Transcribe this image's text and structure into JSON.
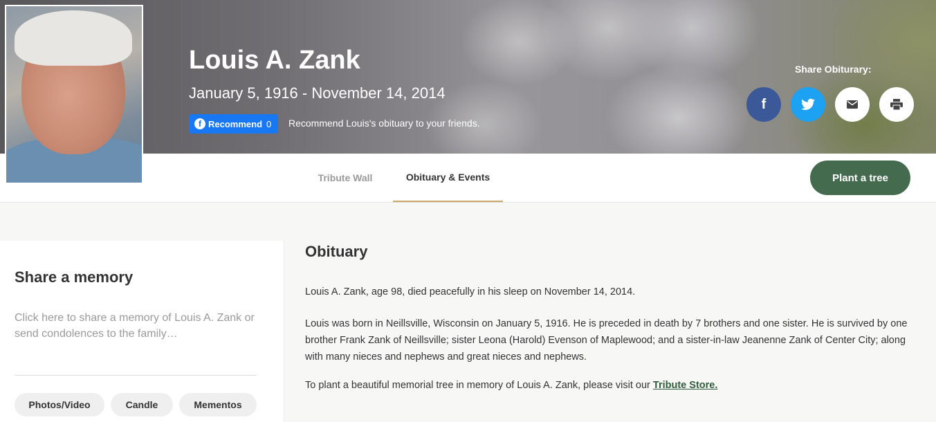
{
  "hero": {
    "name": "Louis A. Zank",
    "dates": "January 5, 1916 - November 14, 2014",
    "recommend_label": "Recommend",
    "recommend_count": "0",
    "recommend_text": "Recommend Louis's obituary to your friends.",
    "share_label": "Share Obiturary:"
  },
  "share_buttons": [
    "facebook-icon",
    "twitter-icon",
    "mail-icon",
    "print-icon"
  ],
  "tabs": {
    "tribute_wall": "Tribute Wall",
    "obituary_events": "Obituary & Events"
  },
  "plant_tree_label": "Plant a tree",
  "memory": {
    "title": "Share a memory",
    "placeholder": "Click here to share a memory of Louis A. Zank or send condolences to the family…",
    "buttons": [
      "Photos/Video",
      "Candle",
      "Mementos"
    ]
  },
  "obituary": {
    "title": "Obituary",
    "p1": "Louis A. Zank, age 98, died peacefully in his sleep on November 14, 2014.",
    "p2": "Louis was born in Neillsville, Wisconsin on January 5, 1916. He is preceded in death by 7 brothers and one sister. He is survived by one brother Frank Zank of Neillsville; sister Leona (Harold) Evenson of Maplewood; and a sister-in-law Jeanenne Zank of Center City; along with many nieces and nephews and great nieces and nephews.",
    "p3_prefix": "To plant a beautiful memorial tree in memory of Louis A. Zank, please visit our ",
    "p3_link": "Tribute Store."
  },
  "colors": {
    "facebook": "#3b5998",
    "twitter": "#1da1f2",
    "plant_button": "#456b4f",
    "tab_underline": "#c8a96a",
    "recommend": "#1877f2"
  }
}
